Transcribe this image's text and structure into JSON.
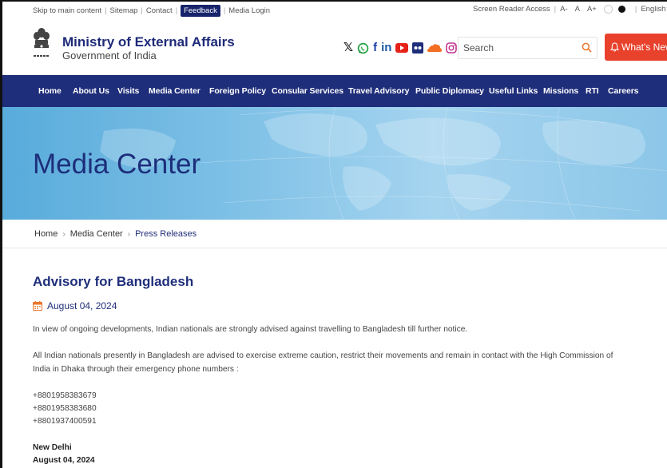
{
  "utility_bar": {
    "left_links": [
      "Skip to main content",
      "Sitemap",
      "Contact"
    ],
    "feedback": "Feedback",
    "media_login": "Media Login",
    "screen_reader": "Screen Reader Access",
    "font_sizes": [
      "A-",
      "A",
      "A+"
    ],
    "language": "English"
  },
  "header": {
    "title": "Ministry of External Affairs",
    "subtitle": "Government of India",
    "social_icons": [
      "x-icon",
      "whatsapp-icon",
      "facebook-icon",
      "linkedin-icon",
      "youtube-icon",
      "flickr-icon",
      "soundcloud-icon",
      "instagram-icon"
    ],
    "search_placeholder": "Search",
    "whats_new": "What's New"
  },
  "nav": [
    "Home",
    "About Us",
    "Visits",
    "Media Center",
    "Foreign Policy",
    "Consular Services",
    "Travel Advisory",
    "Public Diplomacy",
    "Useful Links",
    "Missions",
    "RTI",
    "Careers"
  ],
  "banner": {
    "title": "Media Center"
  },
  "breadcrumb": [
    "Home",
    "Media Center",
    "Press Releases"
  ],
  "article": {
    "title": "Advisory for Bangladesh",
    "date": "August 04, 2024",
    "para1": "In view of ongoing developments, Indian nationals are strongly advised against travelling to Bangladesh till further notice.",
    "para2_line1": "All Indian nationals presently in Bangladesh are advised to exercise extreme caution, restrict their movements and remain in contact with the High Commission of",
    "para2_line2": "India in Dhaka through their emergency phone numbers :",
    "phones": [
      "+8801958383679",
      "+8801958383680",
      "+8801937400591"
    ],
    "place": "New Delhi",
    "sign_date": "August 04, 2024"
  },
  "colors": {
    "navy": "#1f2e7a",
    "orange": "#e8412c",
    "accent_search": "#e8762c"
  }
}
